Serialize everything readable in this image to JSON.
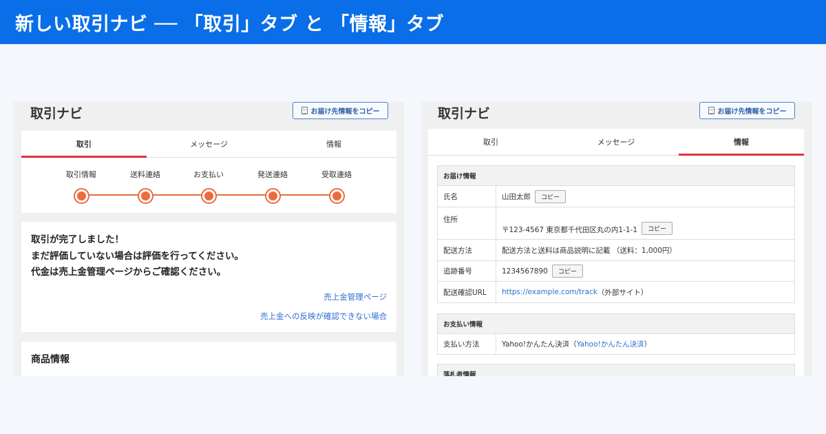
{
  "banner": {
    "title": "新しい取引ナビ ── 「取引」タブ と 「情報」タブ"
  },
  "left_panel": {
    "title": "取引ナビ",
    "copy_button": "お届け先情報をコピー",
    "tabs": [
      {
        "label": "取引",
        "active": true
      },
      {
        "label": "メッセージ",
        "active": false
      },
      {
        "label": "情報",
        "active": false
      }
    ],
    "steps": [
      "取引情報",
      "送料連絡",
      "お支払い",
      "発送連絡",
      "受取連絡"
    ],
    "message_lines": [
      "取引が完了しました！",
      "まだ評価していない場合は評価を行ってください。",
      "代金は売上金管理ページからご確認ください。"
    ],
    "links": [
      "売上金管理ページ",
      "売上金への反映が確認できない場合"
    ],
    "product_section_title": "商品情報"
  },
  "right_panel": {
    "title": "取引ナビ",
    "copy_button": "お届け先情報をコピー",
    "tabs": [
      {
        "label": "取引",
        "active": false
      },
      {
        "label": "メッセージ",
        "active": false
      },
      {
        "label": "情報",
        "active": true
      }
    ],
    "delivery": {
      "heading": "お届け情報",
      "name_label": "氏名",
      "name_value": "山田太郎",
      "address_label": "住所",
      "address_value": "〒123-4567 東京都千代田区丸の内1-1-1",
      "method_label": "配送方法",
      "method_value": "配送方法と送料は商品説明に記載 （送料：1,000円）",
      "tracking_label": "追跡番号",
      "tracking_value": "1234567890",
      "url_label": "配送確認URL",
      "url_link": "https://example.com/track",
      "url_suffix": "（外部サイト）",
      "copy_label": "コピー"
    },
    "payment": {
      "heading": "お支払い情報",
      "method_label": "支払い方法",
      "method_value": "Yahoo!かんたん決済（",
      "method_link": "Yahoo!かんたん決済",
      "method_close": "）"
    },
    "bidder_heading": "落札者情報"
  },
  "colors": {
    "banner": "#0a6ee8",
    "active_tab": "#e0323c",
    "progress": "#ec6b3f",
    "link": "#2a6dd0"
  }
}
